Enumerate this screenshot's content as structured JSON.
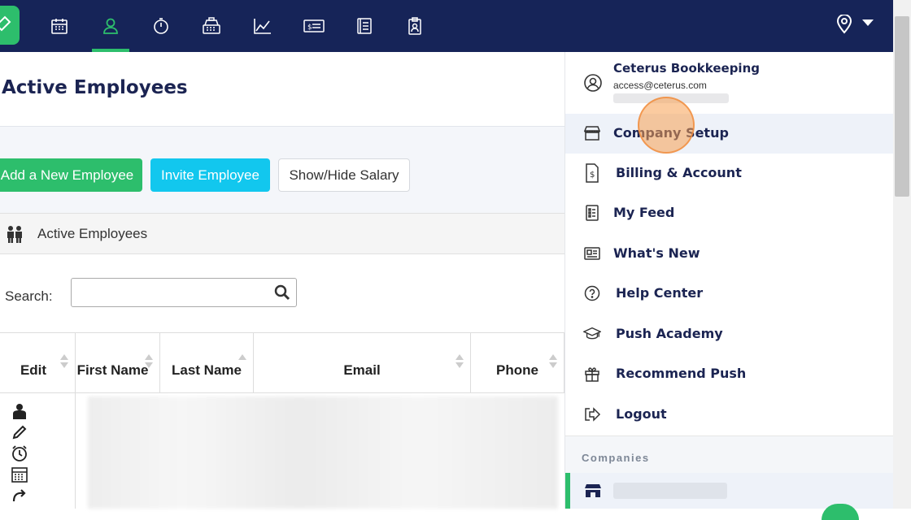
{
  "topnav": {
    "icons": [
      "calendar-icon",
      "person-icon",
      "stopwatch-icon",
      "cash-register-icon",
      "trend-chart-icon",
      "money-bill-icon",
      "notebook-icon",
      "clipboard-icon"
    ],
    "active": "person-icon"
  },
  "page": {
    "title": "Active Employees",
    "buttons": {
      "add": "Add a New Employee",
      "invite": "Invite Employee",
      "salary": "Show/Hide Salary"
    },
    "section_label": "Active Employees",
    "search_label": "Search:",
    "table": {
      "headers": [
        "Edit",
        "First Name",
        "Last Name",
        "Email",
        "Phone"
      ]
    }
  },
  "menu": {
    "profile": {
      "name": "Ceterus Bookkeeping",
      "email": "access@ceterus.com"
    },
    "items": [
      {
        "label": "Company Setup",
        "icon": "store-icon"
      },
      {
        "label": "Billing & Account",
        "icon": "invoice-icon"
      },
      {
        "label": "My Feed",
        "icon": "feed-list-icon"
      },
      {
        "label": "What's New",
        "icon": "newspaper-icon"
      },
      {
        "label": "Help Center",
        "icon": "help-icon"
      },
      {
        "label": "Push Academy",
        "icon": "graduation-cap-icon"
      },
      {
        "label": "Recommend Push",
        "icon": "gift-icon"
      },
      {
        "label": "Logout",
        "icon": "logout-icon"
      }
    ],
    "companies_heading": "Companies"
  },
  "colors": {
    "navy": "#162458",
    "green": "#2dbe6c",
    "cyan": "#12c7ee",
    "highlight": "#eef2f9"
  }
}
